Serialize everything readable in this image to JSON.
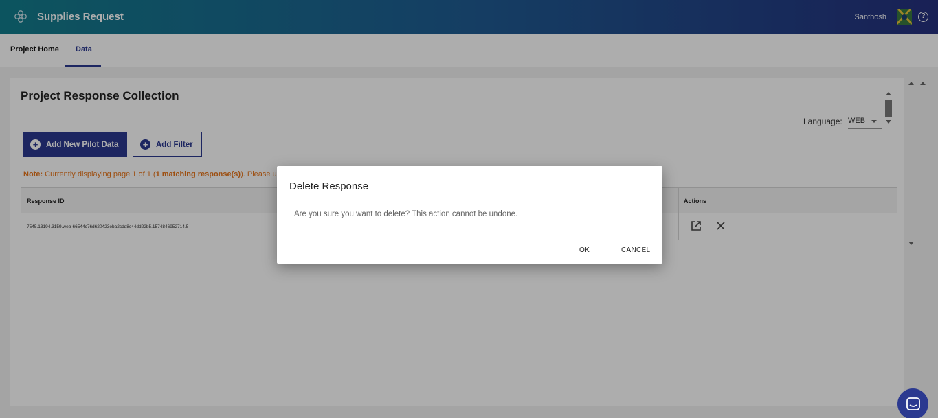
{
  "header": {
    "app_title": "Supplies Request",
    "username": "Santhosh",
    "help_glyph": "?",
    "icons": [
      "app-logo-icon",
      "avatar",
      "help-icon"
    ],
    "gradient_colors": [
      "#137d8c",
      "#1f5c93",
      "#25307e"
    ]
  },
  "tabs": [
    {
      "label": "Project Home",
      "active": false
    },
    {
      "label": "Data",
      "active": true
    }
  ],
  "main": {
    "title": "Project Response Collection",
    "language_label": "Language:",
    "language_value": "WEB",
    "add_pilot_label": "Add New Pilot Data",
    "add_filter_label": "Add Filter",
    "note_prefix": "Note:",
    "note_text_1": " Currently displaying page 1 of 1 (",
    "note_bold": "1 matching response(s)",
    "note_text_2": "). Please use",
    "table": {
      "columns": [
        "Response ID",
        "Actions"
      ],
      "rows": [
        {
          "response_id": "7545.13194.3159.web-66544c76d620423eba2cdd8c44dd22b5.1574846952714.5"
        }
      ]
    }
  },
  "dialog": {
    "title": "Delete Response",
    "message": "Are you sure you want to delete? This action cannot be undone.",
    "ok_label": "OK",
    "cancel_label": "CANCEL"
  },
  "colors": {
    "accent": "#2b3990",
    "note": "#e8751a"
  }
}
